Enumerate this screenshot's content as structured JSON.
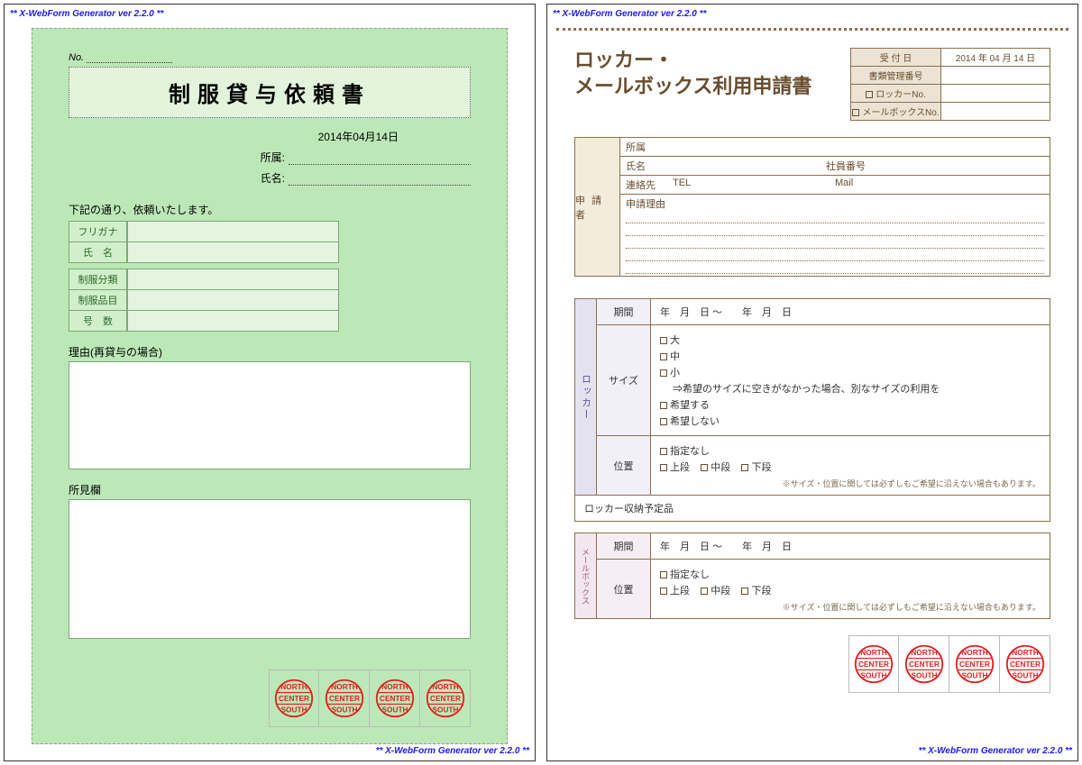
{
  "watermark": "** X-WebForm Generator ver 2.2.0 **",
  "left": {
    "no_label": "No.",
    "title": "制服貸与依頼書",
    "date": "2014年04月14日",
    "affiliation_label": "所属:",
    "name_label": "氏名:",
    "intro": "下記の通り、依頼いたします。",
    "rows": {
      "furigana": "フリガナ",
      "name": "氏　名",
      "category": "制服分類",
      "item": "制服品目",
      "size": "号　数"
    },
    "reason_label": "理由(再貸与の場合)",
    "comment_label": "所見欄"
  },
  "right": {
    "title_line1": "ロッカー・",
    "title_line2": "メールボックス利用申請書",
    "admin": {
      "date_label": "受 付 日",
      "date_value": "2014 年 04 月 14 日",
      "docno_label": "書類管理番号",
      "locker_label": "ロッカーNo.",
      "mail_label": "メールボックスNo."
    },
    "applicant": {
      "side": "申 請 者",
      "affiliation": "所属",
      "name": "氏名",
      "empno": "社員番号",
      "contact": "連絡先",
      "tel": "TEL",
      "mail": "Mail",
      "reason": "申請理由"
    },
    "locker": {
      "side": "ロッカー",
      "period_label": "期間",
      "period_value": "年　月　日 〜　　年　月　日",
      "size_label": "サイズ",
      "size_large": "大",
      "size_med": "中",
      "size_small": "小",
      "size_note": "⇒希望のサイズに空きがなかった場合、別なサイズの利用を",
      "wish_yes": "希望する",
      "wish_no": "希望しない",
      "pos_label": "位置",
      "pos_none": "指定なし",
      "pos_top": "上段",
      "pos_mid": "中段",
      "pos_bot": "下段",
      "pos_note": "※サイズ・位置に関しては必ずしもご希望に沿えない場合もあります。",
      "storage": "ロッカー収納予定品"
    },
    "mailbox": {
      "side": "メールボックス",
      "period_label": "期間",
      "period_value": "年　月　日 〜　　年　月　日",
      "pos_label": "位置",
      "pos_none": "指定なし",
      "pos_top": "上段",
      "pos_mid": "中段",
      "pos_bot": "下段",
      "pos_note": "※サイズ・位置に関しては必ずしもご希望に沿えない場合もあります。"
    }
  },
  "stamp": {
    "top": "NORTH",
    "mid": "CENTER",
    "bot": "SOUTH"
  }
}
